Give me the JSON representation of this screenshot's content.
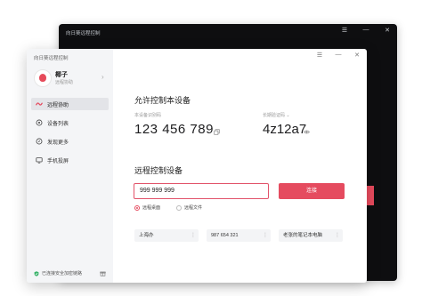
{
  "background_window": {
    "title": "向日葵远程控制",
    "controls": [
      "☰",
      "—",
      "✕"
    ]
  },
  "app": {
    "title": "向日葵远程控制",
    "window_controls": [
      "☰",
      "—",
      "✕"
    ]
  },
  "user": {
    "name": "椰子",
    "subtitle": "远程协助",
    "chevron": "›"
  },
  "sidebar": {
    "items": [
      {
        "label": "远程协助",
        "icon": "remote-assist-icon",
        "active": true
      },
      {
        "label": "设备列表",
        "icon": "device-list-icon",
        "active": false
      },
      {
        "label": "发现更多",
        "icon": "discover-icon",
        "active": false
      },
      {
        "label": "手机投屏",
        "icon": "screen-cast-icon",
        "active": false
      }
    ],
    "secure_text": "已连接安全加密链路"
  },
  "allow_control": {
    "heading": "允许控制本设备",
    "device_code_label": "本设备识别码",
    "device_code": "123 456 789",
    "passcode_label": "长期验证码 ⌄",
    "passcode": "4z12a7"
  },
  "remote_control": {
    "heading": "远程控制设备",
    "input_value": "999 999 999",
    "connect_label": "连接",
    "modes": [
      {
        "label": "远程桌面",
        "checked": true
      },
      {
        "label": "远程文件",
        "checked": false
      }
    ]
  },
  "recent_devices": [
    {
      "label": "上海办"
    },
    {
      "label": "987 654 321"
    },
    {
      "label": "老张的笔记本电脑"
    }
  ],
  "colors": {
    "accent": "#e54b5f",
    "sidebar_bg": "#f4f5f7",
    "dark_window_bg": "#0e0e10"
  }
}
